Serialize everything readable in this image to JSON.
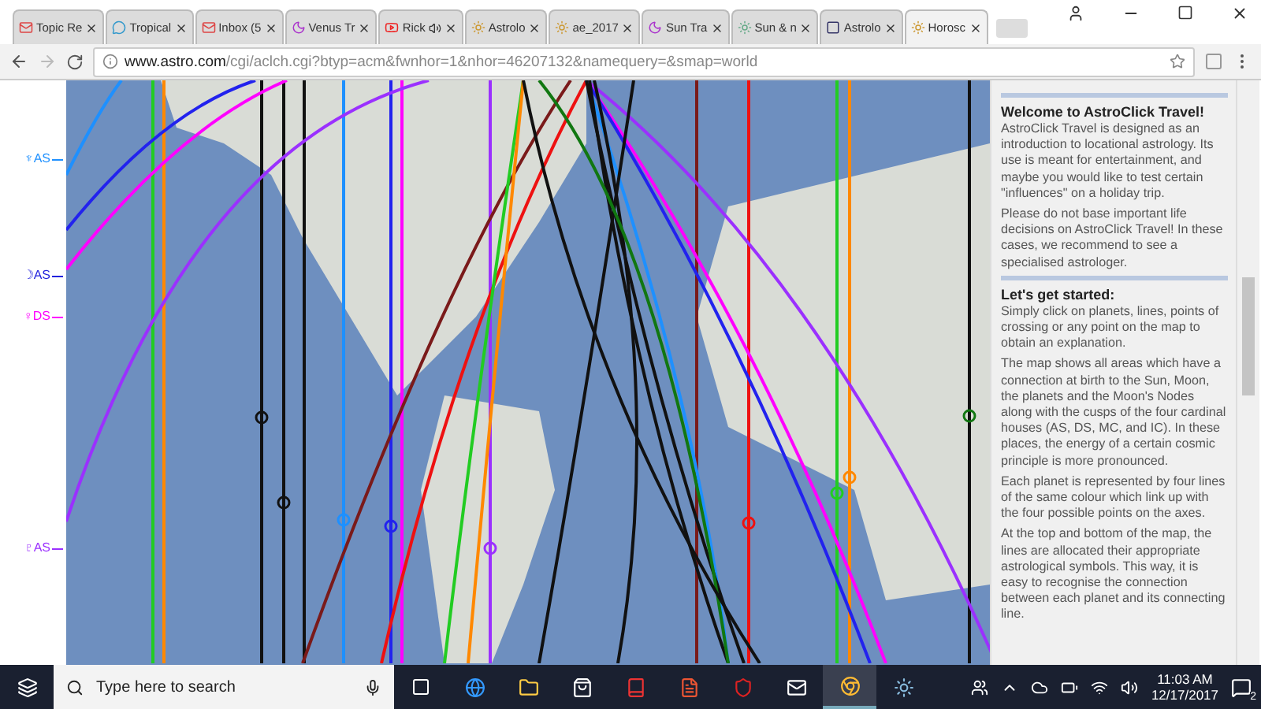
{
  "tabs": [
    {
      "label": "Topic Re",
      "kind": "mail",
      "selected": false,
      "audio": false
    },
    {
      "label": "Tropical",
      "kind": "chat",
      "selected": false,
      "audio": false
    },
    {
      "label": "Inbox (5",
      "kind": "mail",
      "selected": false,
      "audio": false
    },
    {
      "label": "Venus Tr",
      "kind": "moon",
      "selected": false,
      "audio": false
    },
    {
      "label": "Rick",
      "kind": "video",
      "selected": false,
      "audio": true
    },
    {
      "label": "Astrolo",
      "kind": "chart",
      "selected": false,
      "audio": false
    },
    {
      "label": "ae_2017",
      "kind": "chart",
      "selected": false,
      "audio": false
    },
    {
      "label": "Sun Tra",
      "kind": "moon",
      "selected": false,
      "audio": false
    },
    {
      "label": "Sun & n",
      "kind": "dots",
      "selected": false,
      "audio": false
    },
    {
      "label": "Astrolo",
      "kind": "square",
      "selected": false,
      "audio": false
    },
    {
      "label": "Horosc",
      "kind": "chart",
      "selected": true,
      "audio": false
    }
  ],
  "address_bar": {
    "domain": "www.astro.com",
    "path": "/cgi/aclch.cgi?btyp=acm&fwnhor=1&nhor=46207132&namequery=&smap=world"
  },
  "axis_labels": [
    {
      "label": "♆AS",
      "color": "#1e90ff"
    },
    {
      "label": "☽AS",
      "color": "#2222dd"
    },
    {
      "label": "♀DS",
      "color": "#ff00ff"
    },
    {
      "label": "♇AS",
      "color": "#9b30ff"
    }
  ],
  "panel": {
    "sections": [
      {
        "heading": "Welcome to AstroClick Travel!",
        "paragraphs": [
          "AstroClick Travel is designed as an introduction to locational astrology. Its use is meant for entertainment, and maybe you would like to test certain \"influences\" on a holiday trip.",
          "Please do not base important life decisions on AstroClick Travel! In these cases, we recommend to see a specialised astrologer."
        ]
      },
      {
        "heading": "Let's get started:",
        "paragraphs": [
          "Simply click on planets, lines, points of crossing or any point on the map to obtain an explanation.",
          "The map shows all areas which have a connection at birth to the Sun, Moon, the planets and the Moon's Nodes along with the cusps of the four cardinal houses (AS, DS, MC, and IC). In these places, the energy of a certain cosmic principle is more pronounced.",
          "Each planet is represented by four lines of the same colour which link up with the four possible points on the axes.",
          "At the top and bottom of the map, the lines are allocated their appropriate astrological symbols. This way, it is easy to recognise the connection between each planet and its connecting line."
        ]
      }
    ]
  },
  "taskbar": {
    "search_placeholder": "Type here to search",
    "time": "11:03 AM",
    "date": "12/17/2017",
    "notifications": "2"
  }
}
